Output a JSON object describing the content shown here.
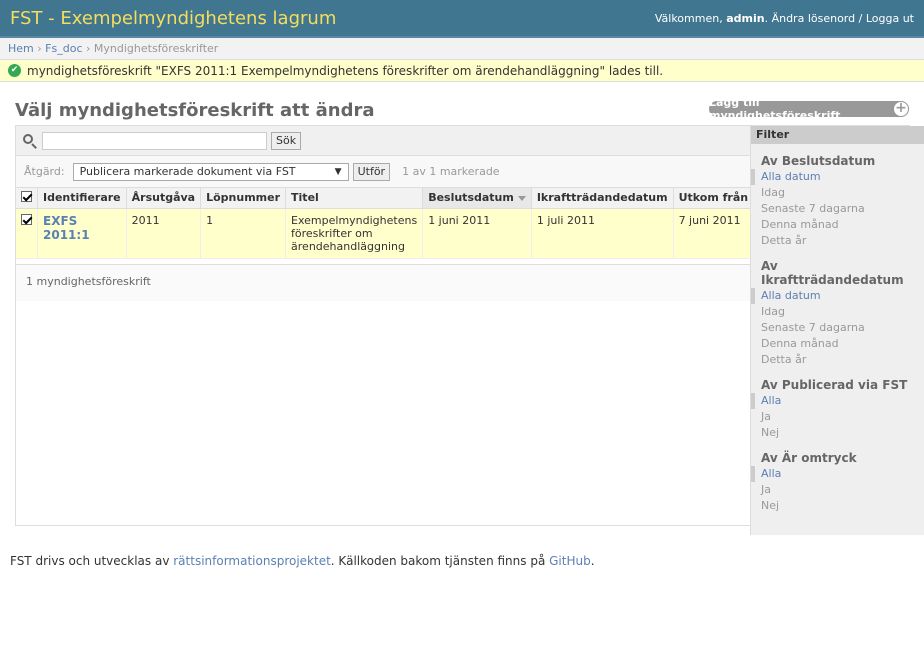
{
  "header": {
    "branding": "FST - Exempelmyndighetens lagrum",
    "welcome": "Välkommen,",
    "username": "admin",
    "separator_1": ".",
    "change_password": "Ändra lösenord",
    "separator_2": "/",
    "logout": "Logga ut"
  },
  "breadcrumbs": {
    "home": "Hem",
    "sep": "›",
    "app": "Fs_doc",
    "current": "Myndighetsföreskrifter"
  },
  "message": "myndighetsföreskrift \"EXFS 2011:1 Exempelmyndighetens föreskrifter om ärendehandläggning\" lades till.",
  "page_title": "Välj myndighetsföreskrift att ändra",
  "add_link": "Lägg till myndighetsföreskrift",
  "search": {
    "placeholder": "",
    "value": "",
    "button": "Sök"
  },
  "actions": {
    "label": "Åtgärd:",
    "selected": "Publicera markerade dokument via FST",
    "go_button": "Utför",
    "counter": "1 av 1 markerade"
  },
  "table": {
    "columns": [
      "Identifierare",
      "Årsutgåva",
      "Löpnummer",
      "Titel",
      "Beslutsdatum",
      "Ikraftträdandedatum",
      "Utkom från"
    ],
    "rows": [
      {
        "checked": true,
        "identifier": "EXFS 2011:1",
        "year": "2011",
        "number": "1",
        "title": "Exempelmyndighetens föreskrifter om ärendehandläggning",
        "decision_date": "1 juni 2011",
        "effective_date": "1 juli 2011",
        "published": "7 juni 2011"
      }
    ]
  },
  "paginator": "1 myndighetsföreskrift",
  "filter": {
    "title": "Filter",
    "groups": [
      {
        "title": "Av Beslutsdatum",
        "items": [
          "Alla datum",
          "Idag",
          "Senaste 7 dagarna",
          "Denna månad",
          "Detta år"
        ]
      },
      {
        "title": "Av Ikraftträdandedatum",
        "items": [
          "Alla datum",
          "Idag",
          "Senaste 7 dagarna",
          "Denna månad",
          "Detta år"
        ]
      },
      {
        "title": "Av Publicerad via FST",
        "items": [
          "Alla",
          "Ja",
          "Nej"
        ]
      },
      {
        "title": "Av Är omtryck",
        "items": [
          "Alla",
          "Ja",
          "Nej"
        ]
      }
    ]
  },
  "footer": {
    "text_1": "FST drivs och utvecklas av",
    "link_1": "rättsinformationsprojektet",
    "text_2": ". Källkoden bakom tjänsten finns på",
    "link_2": "GitHub",
    "text_3": "."
  },
  "colors": {
    "header_bg": "#417690",
    "branding": "#f5dd5d",
    "link": "#5b80b2",
    "selected_row": "#ffffcc",
    "success_icon": "#34a853"
  }
}
